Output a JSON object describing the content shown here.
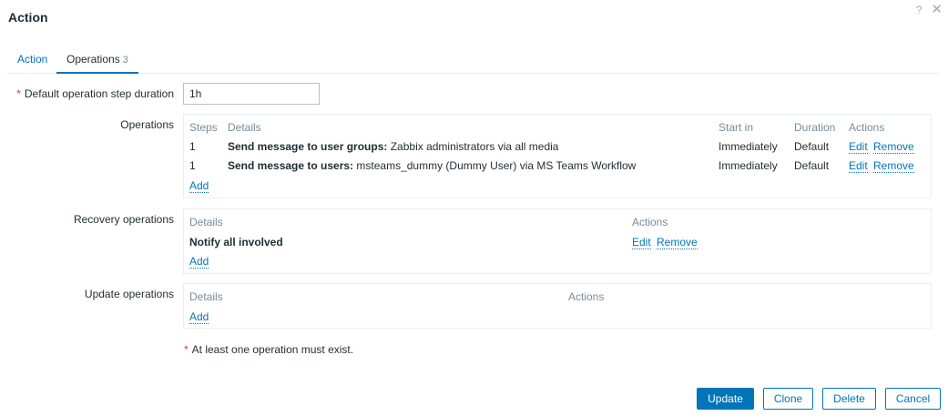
{
  "dialog": {
    "title": "Action",
    "help_icon": "?",
    "close_icon": "✕"
  },
  "tabs": [
    {
      "label": "Action"
    },
    {
      "label": "Operations",
      "count": "3"
    }
  ],
  "step_duration": {
    "label": "Default operation step duration",
    "required_mark": "*",
    "value": "1h"
  },
  "operations": {
    "label": "Operations",
    "headers": {
      "steps": "Steps",
      "details": "Details",
      "start_in": "Start in",
      "duration": "Duration",
      "actions": "Actions"
    },
    "rows": [
      {
        "steps": "1",
        "details_bold": "Send message to user groups:",
        "details_rest": " Zabbix administrators via all media",
        "start_in": "Immediately",
        "duration": "Default",
        "edit": "Edit",
        "remove": "Remove"
      },
      {
        "steps": "1",
        "details_bold": "Send message to users:",
        "details_rest": " msteams_dummy (Dummy User) via MS Teams Workflow",
        "start_in": "Immediately",
        "duration": "Default",
        "edit": "Edit",
        "remove": "Remove"
      }
    ],
    "add": "Add"
  },
  "recovery": {
    "label": "Recovery operations",
    "headers": {
      "details": "Details",
      "actions": "Actions"
    },
    "rows": [
      {
        "details": "Notify all involved",
        "edit": "Edit",
        "remove": "Remove"
      }
    ],
    "add": "Add"
  },
  "update_ops": {
    "label": "Update operations",
    "headers": {
      "details": "Details",
      "actions": "Actions"
    },
    "add": "Add"
  },
  "note": {
    "mark": "*",
    "text": "At least one operation must exist."
  },
  "buttons": {
    "update": "Update",
    "clone": "Clone",
    "delete": "Delete",
    "cancel": "Cancel"
  },
  "colors": {
    "accent": "#0275b8",
    "required": "#e33734",
    "muted": "#768d99"
  }
}
